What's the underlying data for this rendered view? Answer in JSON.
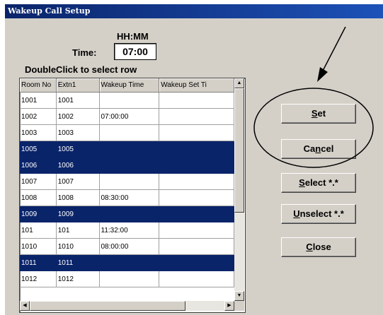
{
  "window": {
    "title": "Wakeup Call Setup"
  },
  "time": {
    "format_label": "HH:MM",
    "label": "Time:",
    "value": "07:00"
  },
  "grid": {
    "hint": "DoubleClick to select row",
    "columns": [
      "Room No",
      "Extn1",
      "Wakeup Time",
      "Wakeup Set Ti"
    ],
    "rows": [
      {
        "room": "1001",
        "extn": "1001",
        "time": "",
        "set": "",
        "selected": false
      },
      {
        "room": "1002",
        "extn": "1002",
        "time": "07:00:00",
        "set": "",
        "selected": false
      },
      {
        "room": "1003",
        "extn": "1003",
        "time": "",
        "set": "",
        "selected": false
      },
      {
        "room": "1005",
        "extn": "1005",
        "time": "",
        "set": "",
        "selected": true
      },
      {
        "room": "1006",
        "extn": "1006",
        "time": "",
        "set": "",
        "selected": true
      },
      {
        "room": "1007",
        "extn": "1007",
        "time": "",
        "set": "",
        "selected": false
      },
      {
        "room": "1008",
        "extn": "1008",
        "time": "08:30:00",
        "set": "",
        "selected": false
      },
      {
        "room": "1009",
        "extn": "1009",
        "time": "",
        "set": "",
        "selected": true
      },
      {
        "room": "101",
        "extn": "101",
        "time": "11:32:00",
        "set": "",
        "selected": false
      },
      {
        "room": "1010",
        "extn": "1010",
        "time": "08:00:00",
        "set": "",
        "selected": false
      },
      {
        "room": "1011",
        "extn": "1011",
        "time": "",
        "set": "",
        "selected": true
      },
      {
        "room": "1012",
        "extn": "1012",
        "time": "",
        "set": "",
        "selected": false
      }
    ]
  },
  "buttons": {
    "set": {
      "key": "S",
      "rest": "et"
    },
    "cancel": {
      "pre": "Ca",
      "key": "n",
      "rest": "cel"
    },
    "select_all": {
      "key": "S",
      "rest": "elect *.*"
    },
    "unselect_all": {
      "key": "U",
      "rest": "nselect *.*"
    },
    "close": {
      "key": "C",
      "rest": "lose"
    }
  },
  "colors": {
    "title_bar": "#0a246a",
    "selection": "#0a246a",
    "face": "#d4d0c8"
  }
}
